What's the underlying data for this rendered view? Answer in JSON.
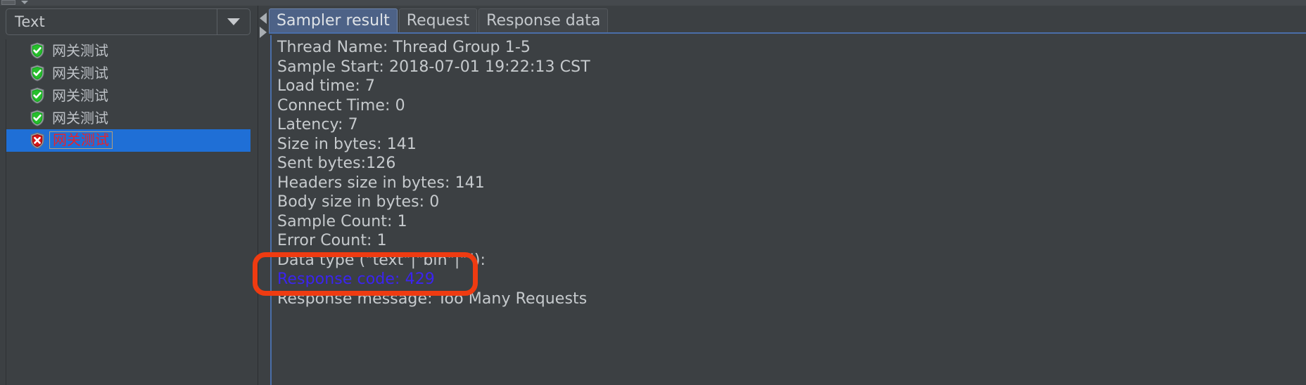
{
  "window": {
    "background_color": "#3c4043",
    "accent_blue": "#1f6fd6",
    "annotation_color": "#ef3b11",
    "response_code_color": "#3b24f0"
  },
  "left_pane": {
    "combo": {
      "value": "Text",
      "arrow_icon": "chevron-down-icon"
    },
    "splitter": {
      "collapse_left_icon": "triangle-left-icon",
      "collapse_right_icon": "triangle-right-icon"
    },
    "tree": {
      "items": [
        {
          "label": "网关测试",
          "status": "success",
          "icon": "green-shield-check-icon",
          "selected": false
        },
        {
          "label": "网关测试",
          "status": "success",
          "icon": "green-shield-check-icon",
          "selected": false
        },
        {
          "label": "网关测试",
          "status": "success",
          "icon": "green-shield-check-icon",
          "selected": false
        },
        {
          "label": "网关测试",
          "status": "success",
          "icon": "green-shield-check-icon",
          "selected": false
        },
        {
          "label": "网关测试",
          "status": "error",
          "icon": "red-shield-cross-icon",
          "selected": true
        }
      ]
    }
  },
  "right_pane": {
    "tabs": [
      {
        "label": "Sampler result",
        "active": true
      },
      {
        "label": "Request",
        "active": false
      },
      {
        "label": "Response data",
        "active": false
      }
    ],
    "sampler_result": {
      "lines": [
        {
          "text": "Thread Name: Thread Group 1-5",
          "highlight": false
        },
        {
          "text": "Sample Start: 2018-07-01 19:22:13 CST",
          "highlight": false
        },
        {
          "text": "Load time: 7",
          "highlight": false
        },
        {
          "text": "Connect Time: 0",
          "highlight": false
        },
        {
          "text": "Latency: 7",
          "highlight": false
        },
        {
          "text": "Size in bytes: 141",
          "highlight": false
        },
        {
          "text": "Sent bytes:126",
          "highlight": false
        },
        {
          "text": "Headers size in bytes: 141",
          "highlight": false
        },
        {
          "text": "Body size in bytes: 0",
          "highlight": false
        },
        {
          "text": "Sample Count: 1",
          "highlight": false
        },
        {
          "text": "Error Count: 1",
          "highlight": false
        },
        {
          "text": "Data type (\"text\"|\"bin\"|\"\"):",
          "highlight": false
        },
        {
          "text": "Response code: 429",
          "highlight": true
        },
        {
          "text": "Response message: Too Many Requests",
          "highlight": false
        }
      ]
    }
  },
  "annotation": {
    "shape": "rounded-rectangle",
    "targets": "Response code: 429"
  }
}
